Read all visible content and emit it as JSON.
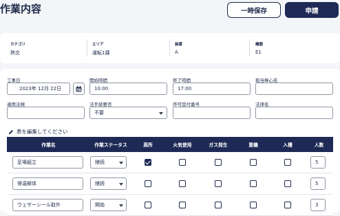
{
  "header": {
    "title": "作業内容",
    "temp_save_label": "一時保存",
    "submit_label": "申請"
  },
  "info": {
    "items": [
      {
        "label": "カテゴリ",
        "value": "熱交"
      },
      {
        "label": "エリア",
        "value": "運転1課"
      },
      {
        "label": "装置",
        "value": "A"
      },
      {
        "label": "機器",
        "value": "E1"
      }
    ]
  },
  "form": {
    "work_date": {
      "label": "工事日",
      "value": "2023年 12月 22日"
    },
    "start_time": {
      "label": "開始時間",
      "value": "10:00"
    },
    "end_time": {
      "label": "終了時間",
      "value": "17:00"
    },
    "manager": {
      "label": "担当棒心名",
      "value": ""
    },
    "applicable_law": {
      "label": "適用法規",
      "value": ""
    },
    "procedure_required": {
      "label": "法手続要否",
      "value": "不要"
    },
    "permit_number": {
      "label": "許可受付番号",
      "value": ""
    },
    "law_name": {
      "label": "法律名",
      "value": ""
    },
    "edit_hint": "表を編集してください"
  },
  "table": {
    "headers": [
      "作業名",
      "作業ステータス",
      "高所",
      "火気使用",
      "ガス発生",
      "重機",
      "入槽",
      "人数"
    ],
    "rows": [
      {
        "name": "足場組立",
        "status": "継続",
        "checks": [
          true,
          false,
          false,
          false,
          false
        ],
        "qty": "5"
      },
      {
        "name": "保温解体",
        "status": "継続",
        "checks": [
          false,
          false,
          false,
          false,
          false
        ],
        "qty": "5"
      },
      {
        "name": "ウェザーシール取外",
        "status": "開始",
        "checks": [
          false,
          false,
          false,
          false,
          false
        ],
        "qty": "3"
      }
    ]
  },
  "colors": {
    "primary": "#1e2a55",
    "background": "#f4f5f8"
  }
}
